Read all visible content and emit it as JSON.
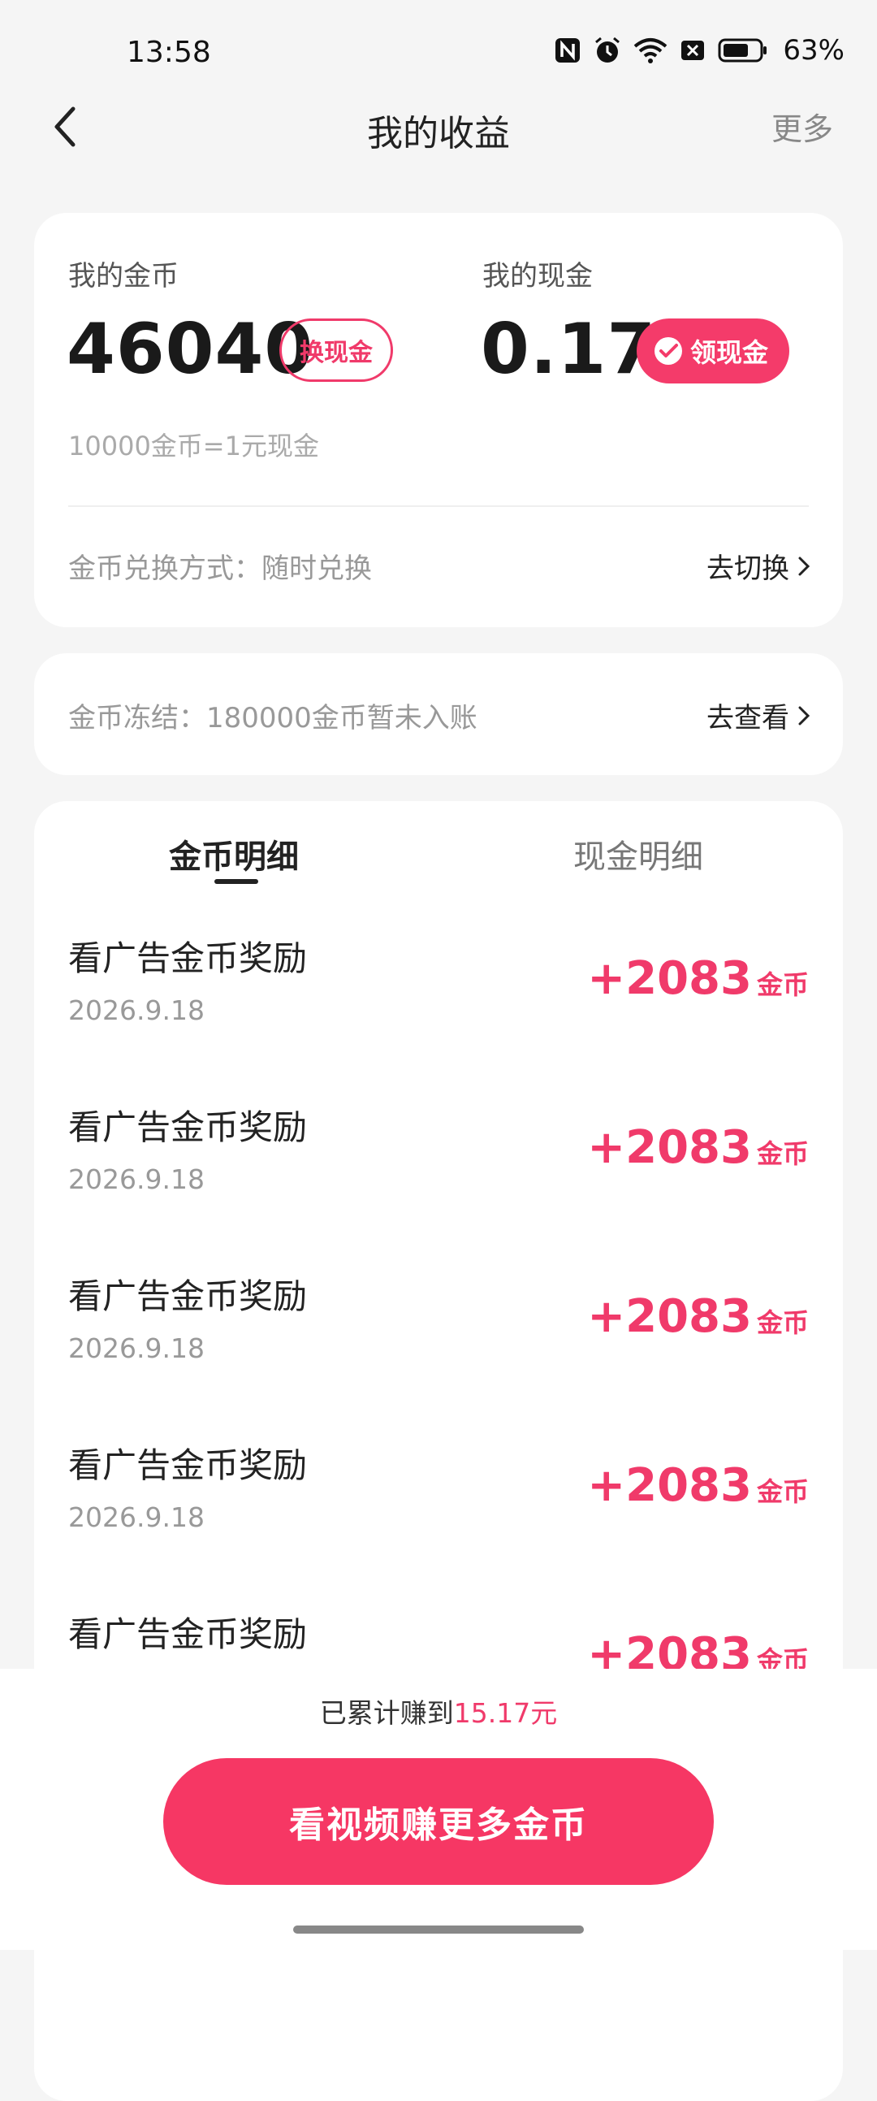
{
  "status_bar": {
    "time": "13:58",
    "battery": "63%",
    "icons": [
      "nfc-icon",
      "alarm-icon",
      "wifi-icon",
      "notification-icon",
      "battery-icon"
    ]
  },
  "header": {
    "title": "我的收益",
    "more": "更多"
  },
  "coins": {
    "label": "我的金币",
    "value": "46040",
    "exchange_button": "换现金",
    "rate": "10000金币=1元现金"
  },
  "cash": {
    "label": "我的现金",
    "value": "0.17",
    "claim_button": "领现金"
  },
  "exchange_method": {
    "text": "金币兑换方式：随时兑换",
    "action": "去切换"
  },
  "frozen": {
    "text": "金币冻结：180000金币暂未入账",
    "action": "去查看"
  },
  "tabs": [
    {
      "label": "金币明细",
      "active": true
    },
    {
      "label": "现金明细",
      "active": false
    }
  ],
  "records": [
    {
      "title": "看广告金币奖励",
      "date": "2026.9.18",
      "amount": "+2083",
      "unit": "金币"
    },
    {
      "title": "看广告金币奖励",
      "date": "2026.9.18",
      "amount": "+2083",
      "unit": "金币"
    },
    {
      "title": "看广告金币奖励",
      "date": "2026.9.18",
      "amount": "+2083",
      "unit": "金币"
    },
    {
      "title": "看广告金币奖励",
      "date": "2026.9.18",
      "amount": "+2083",
      "unit": "金币"
    },
    {
      "title": "看广告金币奖励",
      "date": "",
      "amount": "+2083",
      "unit": "金币"
    }
  ],
  "footer": {
    "earned_prefix": "已累计赚到",
    "earned_amount": "15.17元",
    "cta": "看视频赚更多金币"
  },
  "colors": {
    "accent": "#f03a6a",
    "cta": "#f63764",
    "background": "#f5f5f5"
  }
}
